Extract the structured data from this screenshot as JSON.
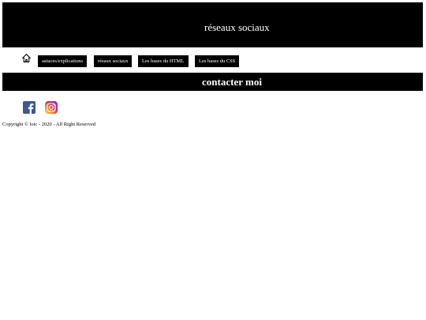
{
  "header": {
    "title": "réseaux sociaux"
  },
  "nav": {
    "home_icon": "home-icon",
    "links": [
      {
        "label": "astuces/explications"
      },
      {
        "label": "résaux sociaux"
      },
      {
        "label": "Les bases du HTML"
      },
      {
        "label": "Les bases du CSS"
      }
    ]
  },
  "contact": {
    "label": "contacter moi"
  },
  "social": [
    {
      "icon": "facebook-icon",
      "color": "#3b5998"
    },
    {
      "icon": "instagram-icon",
      "color": "#dd2a7b"
    }
  ],
  "footer": {
    "copyright": "Copyright © loic - 2020 - All Right Reserved"
  },
  "colors": {
    "bar_background": "#000000",
    "bar_text": "#ffffff",
    "page_background": "#ffffff"
  }
}
